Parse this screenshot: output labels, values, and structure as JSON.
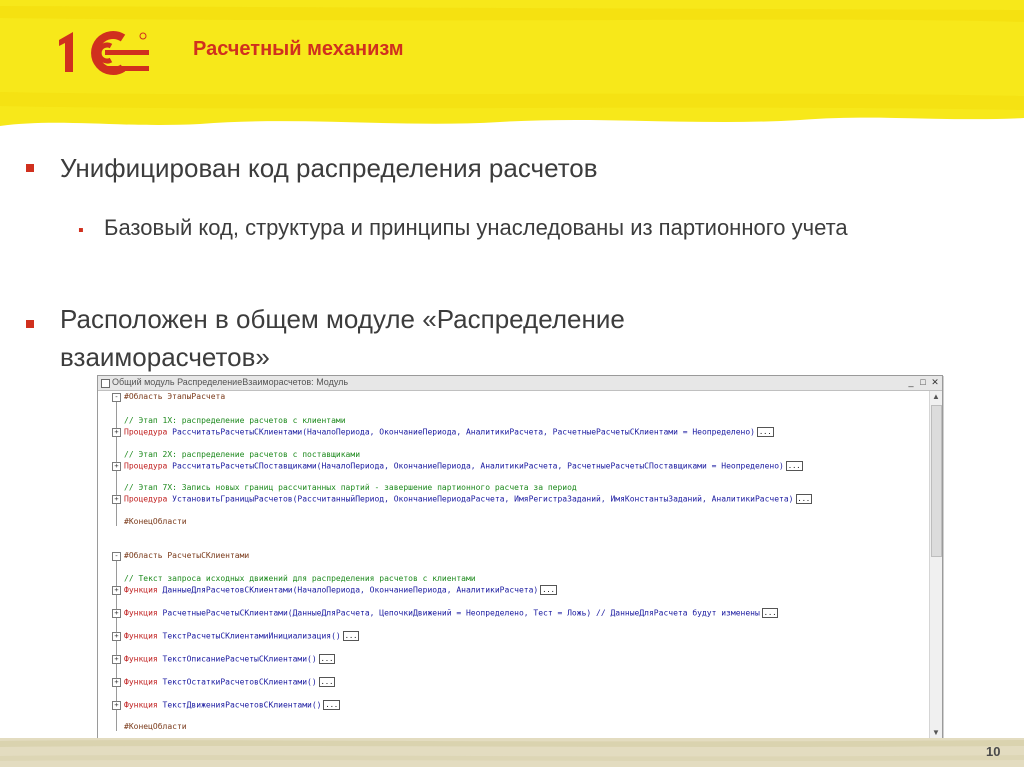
{
  "header": {
    "logo_text": "1С",
    "title": "Расчетный механизм"
  },
  "content": {
    "bullet1": "Унифицирован код распределения расчетов",
    "sub_bullet1": "Базовый код, структура и принципы унаследованы из партионного учета",
    "bullet2": "Расположен в общем модуле «Распределение взаиморасчетов»"
  },
  "window": {
    "title": "Общий модуль РаспределениеВзаиморасчетов: Модуль",
    "min_icon": "minimize-icon",
    "max_icon": "maximize-icon",
    "close_icon": "close-icon"
  },
  "code": {
    "l1_pre": "#Область ЭтапыРасчета",
    "l2_com": "// Этап 1X: распределение расчетов с клиентами",
    "l3_kw": "Процедура",
    "l3_rest": " РассчитатьРасчетыСКлиентами(НачалоПериода, ОкончаниеПериода, АналитикиРасчета, РасчетныеРасчетыСКлиентами = Неопределено)",
    "l4_com": "// Этап 2X: распределение расчетов с поставщиками",
    "l5_kw": "Процедура",
    "l5_rest": " РассчитатьРасчетыСПоставщиками(НачалоПериода, ОкончаниеПериода, АналитикиРасчета, РасчетныеРасчетыСПоставщиками = Неопределено)",
    "l6_com": "// Этап 7X: Запись новых границ рассчитанных партий - завершение партионного расчета за период",
    "l7_kw": "Процедура",
    "l7_rest": " УстановитьГраницыРасчетов(РассчитанныйПериод, ОкончаниеПериодаРасчета, ИмяРегистраЗаданий, ИмяКонстантыЗаданий, АналитикиРасчета)",
    "l8_pre": "#КонецОбласти",
    "l9_pre": "#Область РасчетыСКлиентами",
    "l10_com": "// Текст запроса исходных движений для распределения расчетов с клиентами",
    "l11_kw": "Функция",
    "l11_rest": " ДанныеДляРасчетовСКлиентами(НачалоПериода, ОкончаниеПериода, АналитикиРасчета)",
    "l12_kw": "Функция",
    "l12_rest": " РасчетныеРасчетыСКлиентами(ДанныеДляРасчета, ЦепочкиДвижений = Неопределено, Тест = Ложь) // ДанныеДляРасчета будут изменены",
    "l13_kw": "Функция",
    "l13_rest": " ТекстРасчетыСКлиентамиИнициализация()",
    "l14_kw": "Функция",
    "l14_rest": " ТекстОписаниеРасчетыСКлиентами()",
    "l15_kw": "Функция",
    "l15_rest": " ТекстОстаткиРасчетовСКлиентами()",
    "l16_kw": "Функция",
    "l16_rest": " ТекстДвиженияРасчетовСКлиентами()",
    "l17_pre": "#КонецОбласти",
    "ellipsis": "..."
  },
  "footer": {
    "page_number": "10"
  },
  "colors": {
    "accent": "#d0301e",
    "highlight": "#f7e81a"
  }
}
